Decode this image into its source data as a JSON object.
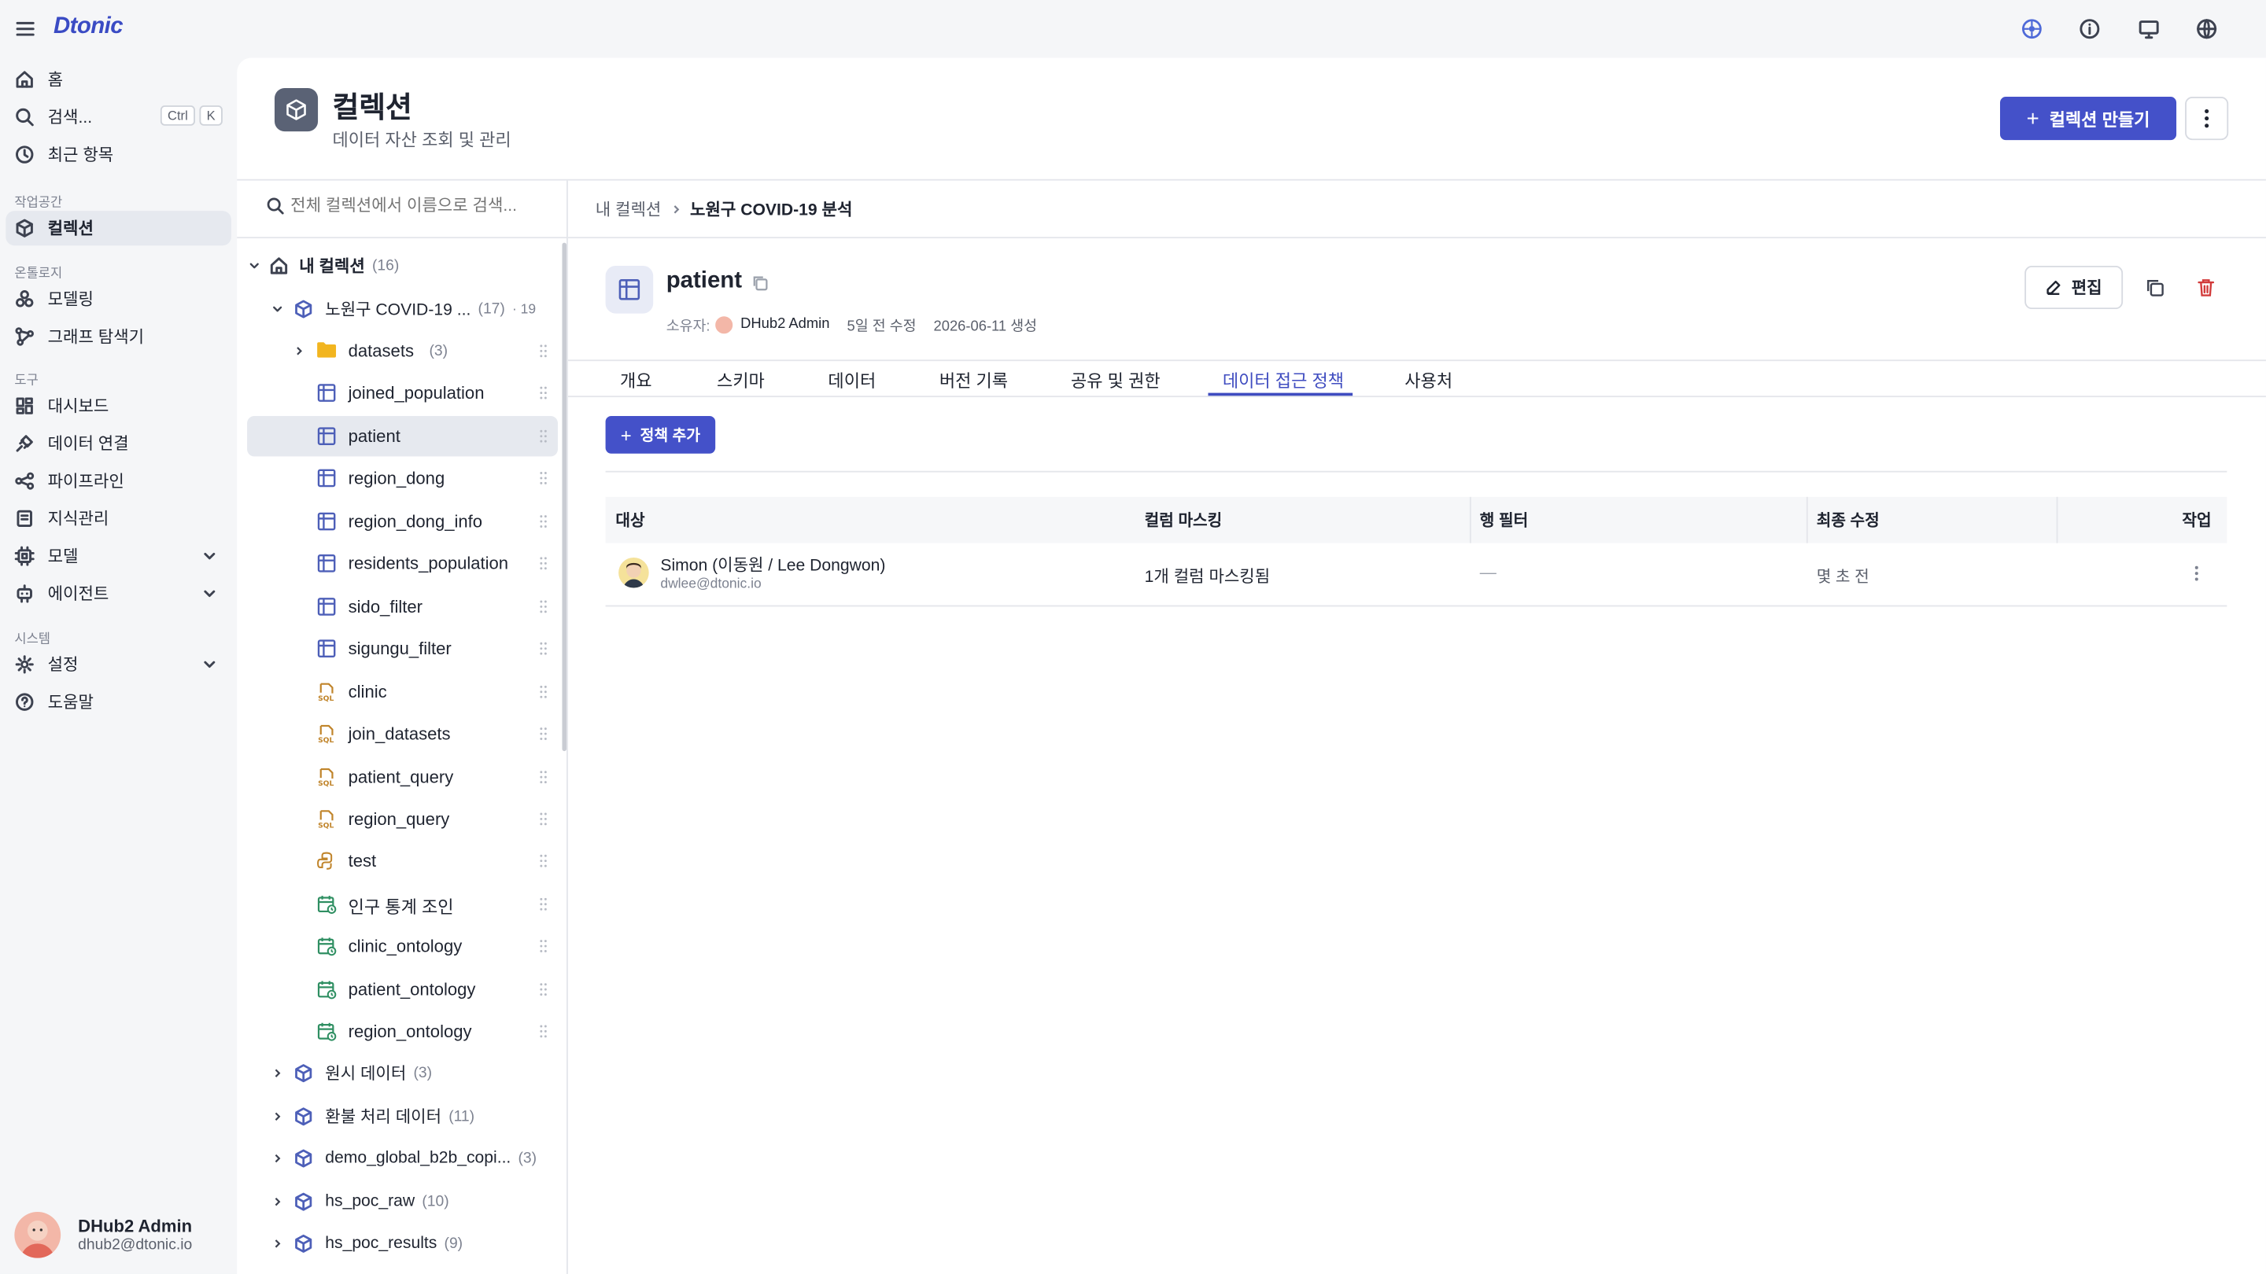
{
  "app": {
    "logo": "Dtonic"
  },
  "sidebar": {
    "top_items": [
      {
        "label": "홈",
        "icon": "home-icon"
      },
      {
        "label": "검색...",
        "icon": "search-icon",
        "shortcut": [
          "Ctrl",
          "K"
        ]
      },
      {
        "label": "최근 항목",
        "icon": "clock-icon"
      }
    ],
    "sections": [
      {
        "title": "작업공간",
        "items": [
          {
            "label": "컬렉션",
            "icon": "cube-icon",
            "active": true
          }
        ]
      },
      {
        "title": "온톨로지",
        "items": [
          {
            "label": "모델링",
            "icon": "modeling-icon"
          },
          {
            "label": "그래프 탐색기",
            "icon": "graph-icon"
          }
        ]
      },
      {
        "title": "도구",
        "items": [
          {
            "label": "대시보드",
            "icon": "dashboard-icon"
          },
          {
            "label": "데이터 연결",
            "icon": "plug-icon"
          },
          {
            "label": "파이프라인",
            "icon": "pipeline-icon"
          },
          {
            "label": "지식관리",
            "icon": "book-icon"
          },
          {
            "label": "모델",
            "icon": "chip-icon",
            "expandable": true
          },
          {
            "label": "에이전트",
            "icon": "robot-icon",
            "expandable": true
          }
        ]
      },
      {
        "title": "시스템",
        "items": [
          {
            "label": "설정",
            "icon": "gear-icon",
            "expandable": true
          },
          {
            "label": "도움말",
            "icon": "help-icon"
          }
        ]
      }
    ],
    "user": {
      "name": "DHub2 Admin",
      "email": "dhub2@dtonic.io"
    }
  },
  "header": {
    "title": "컬렉션",
    "subtitle": "데이터 자산 조회 및 관리",
    "create_button": "컬렉션 만들기"
  },
  "tree": {
    "search_placeholder": "전체 컬렉션에서 이름으로 검색...",
    "root": {
      "label": "내 컬렉션",
      "count": "(16)"
    },
    "collection": {
      "label": "노원구 COVID-19 ...",
      "count": "(17)",
      "extra": "· 19"
    },
    "items": [
      {
        "label": "datasets",
        "count": "(3)",
        "type": "folder"
      },
      {
        "label": "joined_population",
        "type": "table"
      },
      {
        "label": "patient",
        "type": "table",
        "selected": true
      },
      {
        "label": "region_dong",
        "type": "table"
      },
      {
        "label": "region_dong_info",
        "type": "table"
      },
      {
        "label": "residents_population",
        "type": "table"
      },
      {
        "label": "sido_filter",
        "type": "table"
      },
      {
        "label": "sigungu_filter",
        "type": "table"
      },
      {
        "label": "clinic",
        "type": "sql"
      },
      {
        "label": "join_datasets",
        "type": "sql"
      },
      {
        "label": "patient_query",
        "type": "sql"
      },
      {
        "label": "region_query",
        "type": "sql"
      },
      {
        "label": "test",
        "type": "python"
      },
      {
        "label": "인구 통계 조인",
        "type": "schedule"
      },
      {
        "label": "clinic_ontology",
        "type": "schedule"
      },
      {
        "label": "patient_ontology",
        "type": "schedule"
      },
      {
        "label": "region_ontology",
        "type": "schedule"
      }
    ],
    "other_collections": [
      {
        "label": "원시 데이터",
        "count": "(3)"
      },
      {
        "label": "환불 처리 데이터",
        "count": "(11)"
      },
      {
        "label": "demo_global_b2b_copi...",
        "count": "(3)"
      },
      {
        "label": "hs_poc_raw",
        "count": "(10)"
      },
      {
        "label": "hs_poc_results",
        "count": "(9)"
      }
    ]
  },
  "breadcrumb": {
    "parent": "내 컬렉션",
    "current": "노원구 COVID-19 분석"
  },
  "detail": {
    "name": "patient",
    "owner_label": "소유자:",
    "owner": "DHub2 Admin",
    "modified": "5일 전 수정",
    "created": "2026-06-11 생성",
    "edit_button": "편집",
    "tabs": [
      "개요",
      "스키마",
      "데이터",
      "버전 기록",
      "공유 및 권한",
      "데이터 접근 정책",
      "사용처"
    ],
    "active_tab": "데이터 접근 정책",
    "add_policy_button": "정책 추가",
    "table": {
      "headers": [
        "대상",
        "컬럼 마스킹",
        "행 필터",
        "최종 수정",
        "작업"
      ],
      "rows": [
        {
          "name": "Simon (이동원 / Lee Dongwon)",
          "email": "dwlee@dtonic.io",
          "masking": "1개 컬럼 마스킹됨",
          "row_filter": "—",
          "modified": "몇 초 전"
        }
      ]
    }
  },
  "colors": {
    "accent": "#4451c9",
    "delete": "#d23b3b",
    "sql": "#c0842a"
  }
}
